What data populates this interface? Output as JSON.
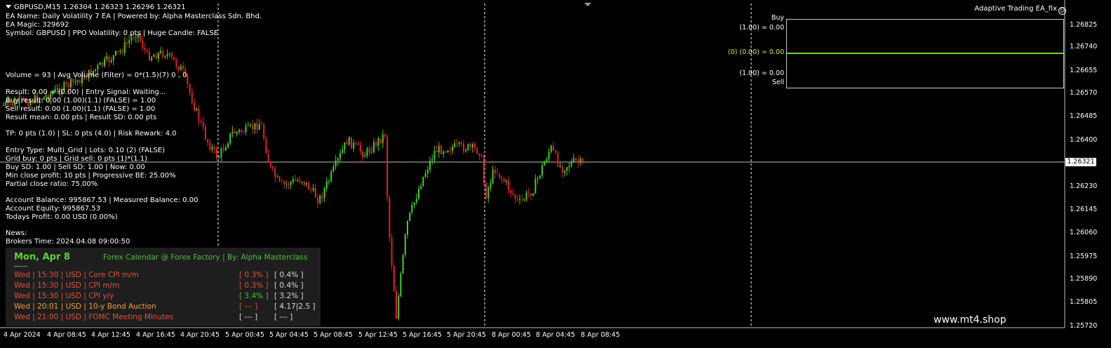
{
  "header": {
    "symbol_line": "GBPUSD,M15  1.26304 1.26323 1.26296 1.26321"
  },
  "ea_info": [
    "EA Name: Daily Volatility 7 EA | Powered by: Alpha Masterclass Sdn. Bhd.",
    "EA Magic: 329692",
    "Symbol: GBPUSD | PPO Volatility: 0 pts | Huge Candle: FALSE",
    "Volume = 93 | Avg Volume (Filter) = 0*(1.5)(7) 0 , 0",
    "Result: 0.00 = (0.00) | Entry Signal: Waiting...",
    "Buy result: 0.00 (1.00)(1.1) (FALSE) = 1.00",
    "Sell result: 0.00 (1.00)(1.1) (FALSE) = 1.00",
    "Result mean: 0.00 pts | Result SD: 0.00 pts",
    "TP: 0 pts (1.0) | SL: 0 pts (4.0) | Risk Rewark: 4.0",
    "Entry Type: Multi_Grid | Lots: 0.10 (2) (FALSE)",
    "Grid buy: 0 pts | Grid sell: 0 pts (1)*(1.1)",
    "Buy SD: 1.00 | Sell SD: 1.00 | Now: 0.00",
    "Min close profit: 10 pts | Progressive BE: 25.00%",
    "Partial close ratio: 75.00%",
    "Account Balance: 995867.53 | Measured Balance: 0.00",
    "Account Equity: 995867.53",
    "Todays Profit: 0.00 USD (0.00%)",
    "News:",
    "Brokers Time: 2024.04.08 09:00:50"
  ],
  "indicator": {
    "title": "Adaptive Trading EA_fix",
    "buy_label": "Buy",
    "sell_label": "Sell",
    "upper_value": "(1.00) = 0.00",
    "mid_value": "(0) (0.00) = 0.00",
    "lower_value": "(1.00) = 0.00",
    "line_color": "#7cd32a"
  },
  "price_axis": {
    "labels": [
      "1.26825",
      "1.26740",
      "1.26655",
      "1.26570",
      "1.26485",
      "1.26400",
      "1.26321",
      "1.26230",
      "1.26145",
      "1.26060",
      "1.25975",
      "1.25890",
      "1.25805",
      "1.25720"
    ],
    "current_price": "1.26321"
  },
  "time_axis": {
    "labels": [
      "4 Apr 2024",
      "4 Apr 08:45",
      "4 Apr 12:45",
      "4 Apr 16:45",
      "4 Apr 20:45",
      "5 Apr 00:45",
      "5 Apr 04:45",
      "5 Apr 08:45",
      "5 Apr 12:45",
      "5 Apr 16:45",
      "5 Apr 20:45",
      "8 Apr 00:45",
      "8 Apr 04:45",
      "8 Apr 08:45"
    ]
  },
  "calendar": {
    "day": "Mon, Apr 8",
    "title": "Forex Calendar @ Forex Factory | By: Alpha Masterclass",
    "separator": "------",
    "rows": [
      {
        "event": "Wed  |  15:30  |  USD  |  Core CPI m/m",
        "actual": "[ 0.3% ]",
        "forecast": "[ 0.4% ]",
        "color": "#e0533c",
        "actual_color": "#e0533c"
      },
      {
        "event": "Wed  |  15:30  |  USD  |  CPI m/m",
        "actual": "[ 0.3% ]",
        "forecast": "[ 0.4% ]",
        "color": "#e0533c",
        "actual_color": "#e0533c"
      },
      {
        "event": "Wed  |  15:30  |  USD  |  CPI y/y",
        "actual": "[ 3.4% ]",
        "forecast": "[ 3.2% ]",
        "color": "#e0533c",
        "actual_color": "#4fbf3c"
      },
      {
        "event": "Wed  |  20:01  |  USD  |  10-y Bond Auction",
        "actual": "[ --- ]",
        "forecast": "[ 4.17|2.5 ]",
        "color": "#f0a030",
        "actual_color": "#e0533c"
      },
      {
        "event": "Wed  |  21:00  |  USD  |  FOMC Meeting Minutes",
        "actual": "[ --- ]",
        "forecast": "[ --- ]",
        "color": "#e0533c",
        "actual_color": "#d8d8d8"
      }
    ]
  },
  "watermark": "www.mt4.shop",
  "colors": {
    "bull": "#3fd22b",
    "bear": "#e8202a",
    "background": "#000000",
    "grid": "#ffffff"
  }
}
